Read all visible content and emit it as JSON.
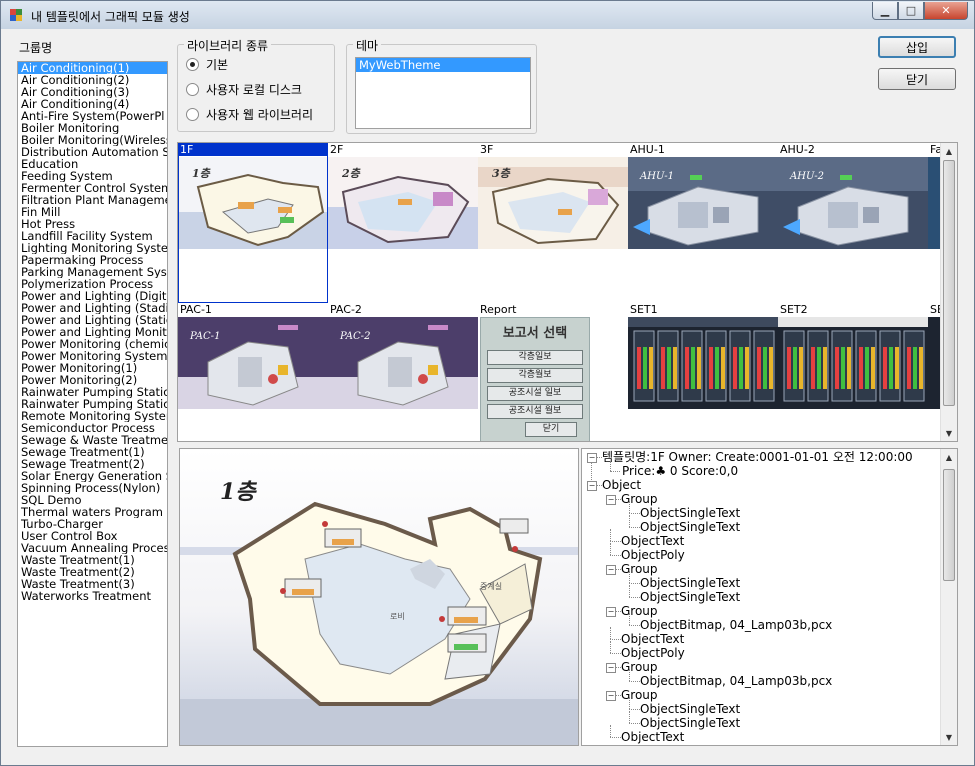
{
  "window": {
    "title": "내 템플릿에서 그래픽 모듈 생성",
    "controls": [
      "minimize",
      "maximize",
      "close"
    ]
  },
  "group_list": {
    "label": "그룹명",
    "items": [
      "Air Conditioning(1)",
      "Air Conditioning(2)",
      "Air Conditioning(3)",
      "Air Conditioning(4)",
      "Anti-Fire System(PowerPl",
      "Boiler Monitoring",
      "Boiler Monitoring(Wireless",
      "Distribution Automation Sy",
      "Education",
      "Feeding System",
      "Fermenter Control System",
      "Filtration Plant Manageme",
      "Fin Mill",
      "Hot Press",
      "Landfill Facility System",
      "Lighting Monitoring Syster",
      "Papermaking Process",
      "Parking Management Sys",
      "Polymerization Process",
      "Power and Lighting (Digita",
      "Power and Lighting (Stadiu",
      "Power and Lighting (Statio",
      "Power and Lighting Monito",
      "Power Monitoring (chemic",
      "Power Monitoring System",
      "Power Monitoring(1)",
      "Power Monitoring(2)",
      "Rainwater Pumping Statio",
      "Rainwater Pumping Statio",
      "Remote Monitoring Syster",
      "Semiconductor Process",
      "Sewage & Waste Treatme",
      "Sewage Treatment(1)",
      "Sewage Treatment(2)",
      "Solar Energy Generation S",
      "Spinning Process(Nylon)",
      "SQL Demo",
      "Thermal waters Program",
      "Turbo-Charger",
      "User Control Box",
      "Vacuum Annealing Proces",
      "Waste Treatment(1)",
      "Waste Treatment(2)",
      "Waste Treatment(3)",
      "Waterworks Treatment"
    ],
    "selected_index": 0
  },
  "library_type": {
    "label": "라이브러리 종류",
    "options": [
      "기본",
      "사용자 로컬 디스크",
      "사용자 웹 라이브러리"
    ],
    "selected_index": 0
  },
  "theme": {
    "label": "테마",
    "items": [
      "MyWebTheme"
    ],
    "selected_index": 0
  },
  "buttons": {
    "insert": "삽입",
    "close": "닫기"
  },
  "gallery": {
    "thumbnails": [
      {
        "caption": "1F",
        "selected": true,
        "img_label": "1층"
      },
      {
        "caption": "2F",
        "selected": false,
        "img_label": "2층"
      },
      {
        "caption": "3F",
        "selected": false,
        "img_label": "3층"
      },
      {
        "caption": "AHU-1",
        "selected": false,
        "img_label": "AHU-1"
      },
      {
        "caption": "AHU-2",
        "selected": false,
        "img_label": "AHU-2"
      },
      {
        "caption": "Fa",
        "selected": false,
        "img_label": ""
      },
      {
        "caption": "PAC-1",
        "selected": false,
        "img_label": "PAC-1"
      },
      {
        "caption": "PAC-2",
        "selected": false,
        "img_label": "PAC-2"
      },
      {
        "caption": "Report",
        "selected": false,
        "img_label": "보고서 선택"
      },
      {
        "caption": "SET1",
        "selected": false,
        "img_label": ""
      },
      {
        "caption": "SET2",
        "selected": false,
        "img_label": ""
      },
      {
        "caption": "SE",
        "selected": false,
        "img_label": ""
      }
    ],
    "report_buttons": [
      "각층일보",
      "각층월보",
      "공조시설 일보",
      "공조시설 월보",
      "닫기"
    ]
  },
  "preview": {
    "floor_label": "1층",
    "room_labels": [
      "로비",
      "중계실"
    ]
  },
  "tree": {
    "info_line": "템플릿명:1F Owner: Create:0001-01-01 오전 12:00:00",
    "price_line": "Price:♣ 0  Score:0,0",
    "nodes": [
      {
        "text": "Object",
        "level": 0,
        "toggle": "−"
      },
      {
        "text": "Group",
        "level": 1,
        "toggle": "−"
      },
      {
        "text": "ObjectSingleText",
        "level": 2
      },
      {
        "text": "ObjectSingleText",
        "level": 2
      },
      {
        "text": "ObjectText",
        "level": 1
      },
      {
        "text": "ObjectPoly",
        "level": 1
      },
      {
        "text": "Group",
        "level": 1,
        "toggle": "−"
      },
      {
        "text": "ObjectSingleText",
        "level": 2
      },
      {
        "text": "ObjectSingleText",
        "level": 2
      },
      {
        "text": "Group",
        "level": 1,
        "toggle": "−"
      },
      {
        "text": "ObjectBitmap, 04_Lamp03b,pcx",
        "level": 2
      },
      {
        "text": "ObjectText",
        "level": 1
      },
      {
        "text": "ObjectPoly",
        "level": 1
      },
      {
        "text": "Group",
        "level": 1,
        "toggle": "−"
      },
      {
        "text": "ObjectBitmap, 04_Lamp03b,pcx",
        "level": 2
      },
      {
        "text": "Group",
        "level": 1,
        "toggle": "−"
      },
      {
        "text": "ObjectSingleText",
        "level": 2
      },
      {
        "text": "ObjectSingleText",
        "level": 2
      },
      {
        "text": "ObjectText",
        "level": 1
      }
    ]
  }
}
